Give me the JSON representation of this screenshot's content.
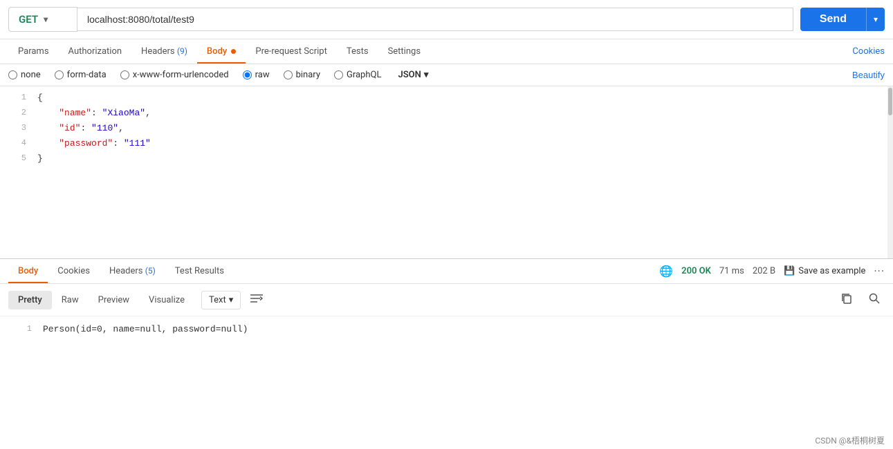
{
  "url_bar": {
    "method": "GET",
    "url": "localhost:8080/total/test9",
    "send_label": "Send"
  },
  "req_tabs": {
    "items": [
      {
        "label": "Params",
        "active": false,
        "badge": null,
        "dot": false
      },
      {
        "label": "Authorization",
        "active": false,
        "badge": null,
        "dot": false
      },
      {
        "label": "Headers",
        "active": false,
        "badge": "(9)",
        "dot": false
      },
      {
        "label": "Body",
        "active": true,
        "badge": null,
        "dot": true
      },
      {
        "label": "Pre-request Script",
        "active": false,
        "badge": null,
        "dot": false
      },
      {
        "label": "Tests",
        "active": false,
        "badge": null,
        "dot": false
      },
      {
        "label": "Settings",
        "active": false,
        "badge": null,
        "dot": false
      }
    ],
    "cookies_label": "Cookies"
  },
  "body_options": {
    "options": [
      "none",
      "form-data",
      "x-www-form-urlencoded",
      "raw",
      "binary",
      "GraphQL"
    ],
    "selected": "raw",
    "format": "JSON",
    "beautify_label": "Beautify"
  },
  "code_editor": {
    "lines": [
      {
        "num": 1,
        "content": "{"
      },
      {
        "num": 2,
        "key": "name",
        "value": "XiaoMa"
      },
      {
        "num": 3,
        "key": "id",
        "value": "110"
      },
      {
        "num": 4,
        "key": "password",
        "value": "111"
      },
      {
        "num": 5,
        "content": "}"
      }
    ]
  },
  "resp_tabs": {
    "items": [
      {
        "label": "Body",
        "active": true,
        "badge": null
      },
      {
        "label": "Cookies",
        "active": false,
        "badge": null
      },
      {
        "label": "Headers",
        "active": false,
        "badge": "(5)"
      },
      {
        "label": "Test Results",
        "active": false,
        "badge": null
      }
    ],
    "status": "200 OK",
    "time": "71 ms",
    "size": "202 B",
    "save_example_label": "Save as example",
    "more_label": "···"
  },
  "resp_format": {
    "tabs": [
      "Pretty",
      "Raw",
      "Preview",
      "Visualize"
    ],
    "active": "Pretty",
    "text_label": "Text",
    "wrap_icon": "wrap"
  },
  "resp_body": {
    "line_num": 1,
    "content": "Person(id=0, name=null, password=null)"
  },
  "footer": {
    "text": "CSDN @&梧桐树夏"
  }
}
